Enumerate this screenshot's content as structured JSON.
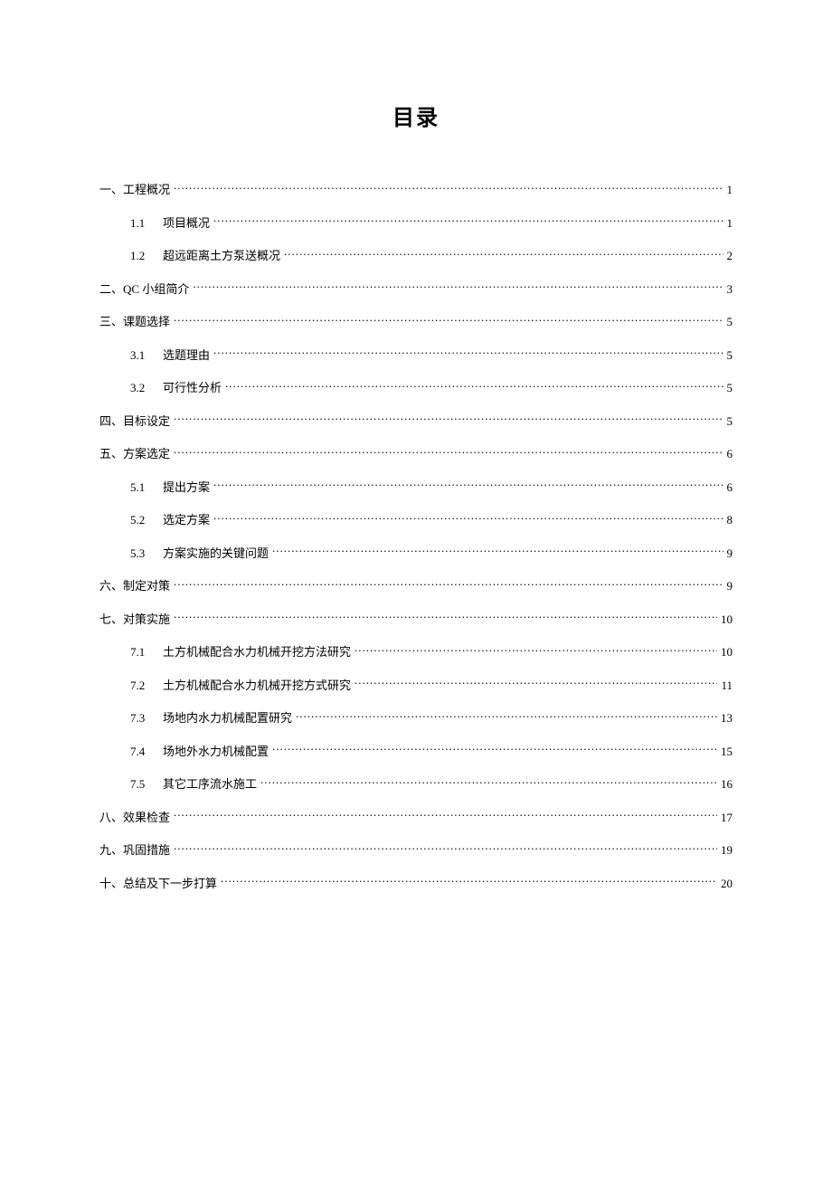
{
  "title": "目录",
  "toc": [
    {
      "level": 1,
      "num": "一、",
      "label": "工程概况",
      "page": "1"
    },
    {
      "level": 2,
      "num": "1.1",
      "label": "项目概况",
      "page": "1"
    },
    {
      "level": 2,
      "num": "1.2",
      "label": "超远距离土方泵送概况",
      "page": "2"
    },
    {
      "level": 1,
      "num": "二、",
      "label": "QC 小组简介",
      "page": "3"
    },
    {
      "level": 1,
      "num": "三、",
      "label": "课题选择",
      "page": "5"
    },
    {
      "level": 2,
      "num": "3.1",
      "label": "选题理由",
      "page": "5"
    },
    {
      "level": 2,
      "num": "3.2",
      "label": "可行性分析",
      "page": "5"
    },
    {
      "level": 1,
      "num": "四、",
      "label": "目标设定",
      "page": "5"
    },
    {
      "level": 1,
      "num": "五、",
      "label": "方案选定",
      "page": "6"
    },
    {
      "level": 2,
      "num": "5.1",
      "label": "提出方案",
      "page": "6"
    },
    {
      "level": 2,
      "num": "5.2",
      "label": "选定方案",
      "page": "8"
    },
    {
      "level": 2,
      "num": "5.3",
      "label": "方案实施的关键问题",
      "page": "9"
    },
    {
      "level": 1,
      "num": "六、",
      "label": "制定对策",
      "page": "9"
    },
    {
      "level": 1,
      "num": "七、",
      "label": "对策实施",
      "page": "10"
    },
    {
      "level": 2,
      "num": "7.1",
      "label": "土方机械配合水力机械开挖方法研究",
      "page": "10"
    },
    {
      "level": 2,
      "num": "7.2",
      "label": "土方机械配合水力机械开挖方式研究",
      "page": "11"
    },
    {
      "level": 2,
      "num": "7.3",
      "label": "场地内水力机械配置研究",
      "page": "13"
    },
    {
      "level": 2,
      "num": "7.4",
      "label": "场地外水力机械配置",
      "page": "15"
    },
    {
      "level": 2,
      "num": "7.5",
      "label": "其它工序流水施工",
      "page": "16"
    },
    {
      "level": 1,
      "num": "八、",
      "label": "效果检查",
      "page": "17"
    },
    {
      "level": 1,
      "num": "九、",
      "label": "巩固措施",
      "page": "19"
    },
    {
      "level": 1,
      "num": "十、",
      "label": "总结及下一步打算",
      "page": "20"
    }
  ]
}
